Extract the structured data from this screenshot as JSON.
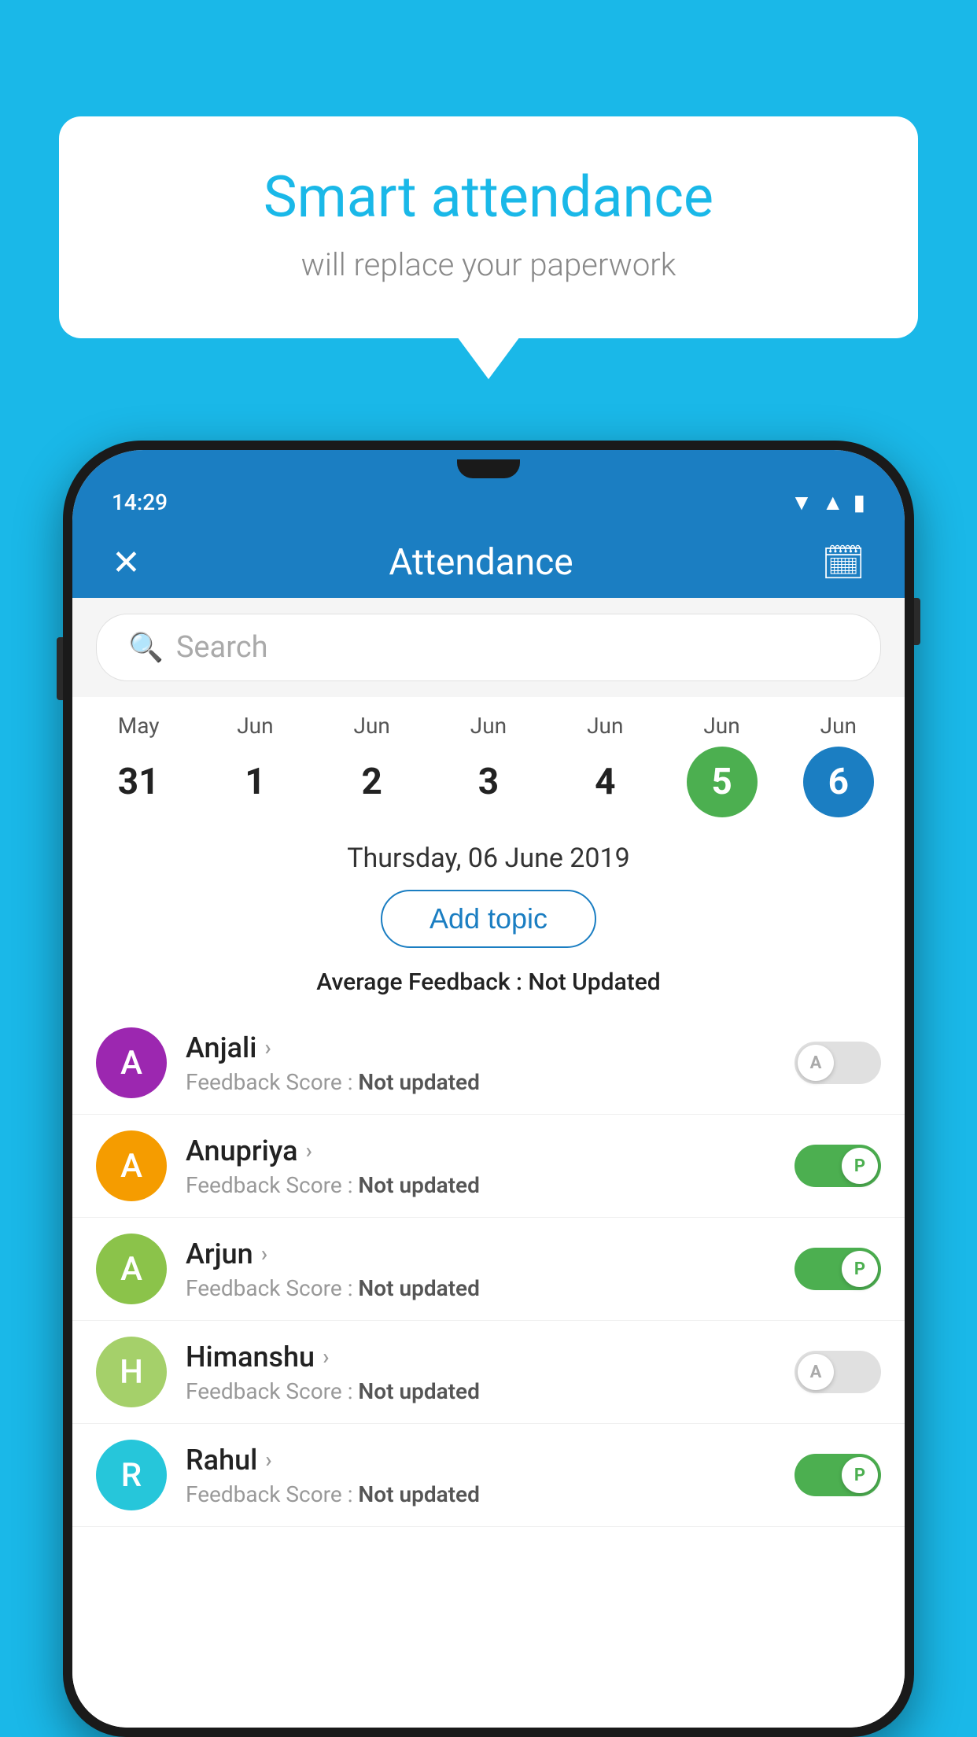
{
  "background_color": "#1ab8e8",
  "bubble": {
    "title": "Smart attendance",
    "subtitle": "will replace your paperwork"
  },
  "status_bar": {
    "time": "14:29",
    "wifi_icon": "▼",
    "signal_icon": "▲",
    "battery_icon": "▮"
  },
  "app_header": {
    "close_icon": "✕",
    "title": "Attendance",
    "calendar_icon": "📅"
  },
  "search": {
    "placeholder": "Search"
  },
  "calendar": {
    "days": [
      {
        "month": "May",
        "date": "31",
        "style": "normal"
      },
      {
        "month": "Jun",
        "date": "1",
        "style": "normal"
      },
      {
        "month": "Jun",
        "date": "2",
        "style": "normal"
      },
      {
        "month": "Jun",
        "date": "3",
        "style": "normal"
      },
      {
        "month": "Jun",
        "date": "4",
        "style": "normal"
      },
      {
        "month": "Jun",
        "date": "5",
        "style": "green"
      },
      {
        "month": "Jun",
        "date": "6",
        "style": "blue"
      }
    ]
  },
  "selected_date": "Thursday, 06 June 2019",
  "add_topic_label": "Add topic",
  "avg_feedback": {
    "label": "Average Feedback : ",
    "value": "Not Updated"
  },
  "students": [
    {
      "name": "Anjali",
      "avatar_letter": "A",
      "avatar_color": "#9c27b0",
      "feedback": "Not updated",
      "status": "absent",
      "toggle_label": "A"
    },
    {
      "name": "Anupriya",
      "avatar_letter": "A",
      "avatar_color": "#f59c00",
      "feedback": "Not updated",
      "status": "present",
      "toggle_label": "P"
    },
    {
      "name": "Arjun",
      "avatar_letter": "A",
      "avatar_color": "#8bc34a",
      "feedback": "Not updated",
      "status": "present",
      "toggle_label": "P"
    },
    {
      "name": "Himanshu",
      "avatar_letter": "H",
      "avatar_color": "#a5d06a",
      "feedback": "Not updated",
      "status": "absent",
      "toggle_label": "A"
    },
    {
      "name": "Rahul",
      "avatar_letter": "R",
      "avatar_color": "#26c6da",
      "feedback": "Not updated",
      "status": "present",
      "toggle_label": "P"
    }
  ],
  "feedback_score_label": "Feedback Score : "
}
